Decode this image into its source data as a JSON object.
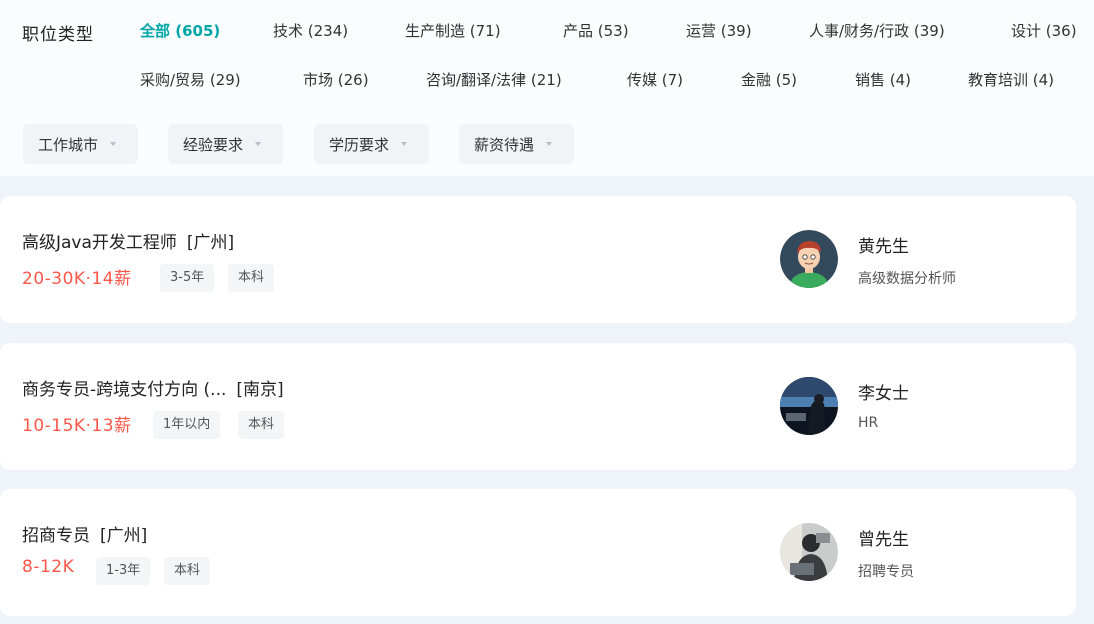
{
  "filters_panel": {
    "type_label": "职位类型",
    "categories_row1": [
      {
        "label": "全部 (605)",
        "active": true
      },
      {
        "label": "技术 (234)"
      },
      {
        "label": "生产制造 (71)"
      },
      {
        "label": "产品 (53)"
      },
      {
        "label": "运营 (39)"
      },
      {
        "label": "人事/财务/行政 (39)"
      },
      {
        "label": "设计 (36)"
      }
    ],
    "categories_row2": [
      {
        "label": "采购/贸易 (29)"
      },
      {
        "label": "市场 (26)"
      },
      {
        "label": "咨询/翻译/法律 (21)"
      },
      {
        "label": "传媒 (7)"
      },
      {
        "label": "金融 (5)"
      },
      {
        "label": "销售 (4)"
      },
      {
        "label": "教育培训 (4)"
      }
    ],
    "dropdowns": [
      {
        "label": "工作城市"
      },
      {
        "label": "经验要求"
      },
      {
        "label": "学历要求"
      },
      {
        "label": "薪资待遇"
      }
    ]
  },
  "jobs": [
    {
      "title": "高级Java开发工程师",
      "city": "[广州]",
      "salary": "20-30K·14薪",
      "tags": [
        "3-5年",
        "本科"
      ],
      "recruiter": {
        "name": "黄先生",
        "title": "高级数据分析师",
        "avatar_icon": "cartoon-man-avatar"
      }
    },
    {
      "title": "商务专员-跨境支付方向 (...",
      "city": "[南京]",
      "salary": "10-15K·13薪",
      "tags": [
        "1年以内",
        "本科"
      ],
      "recruiter": {
        "name": "李女士",
        "title": "HR",
        "avatar_icon": "photo-avatar-woman"
      }
    },
    {
      "title": "招商专员",
      "city": "[广州]",
      "salary": "8-12K",
      "tags": [
        "1-3年",
        "本科"
      ],
      "recruiter": {
        "name": "曾先生",
        "title": "招聘专员",
        "avatar_icon": "photo-avatar-man"
      }
    }
  ],
  "colors": {
    "accent": "#00a6a7",
    "salary": "#fe574a",
    "tag_bg": "#f3f5f7",
    "page_bg": "#eef4fa"
  }
}
